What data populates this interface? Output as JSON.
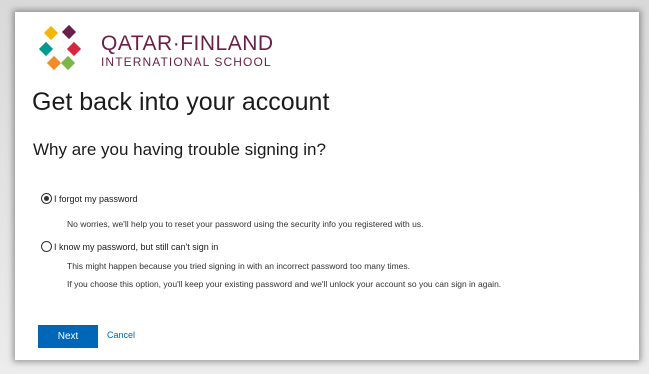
{
  "brand": {
    "name": "QATAR·FINLAND",
    "subtitle": "INTERNATIONAL SCHOOL",
    "colors": {
      "name_text": "#6a1f47",
      "leaf_yellow": "#f2b705",
      "leaf_red": "#d7263d",
      "leaf_teal": "#009a8e",
      "leaf_orange": "#f28c28",
      "leaf_maroon": "#6a1f47",
      "leaf_green": "#7ab648"
    }
  },
  "page": {
    "title": "Get back into your account",
    "question": "Why are you having trouble signing in?"
  },
  "options": [
    {
      "label": "I forgot my password",
      "checked": true,
      "descriptions": [
        "No worries, we'll help you to reset your password using the security info you registered with us."
      ]
    },
    {
      "label": "I know my password, but still can't sign in",
      "checked": false,
      "descriptions": [
        "This might happen because you tried signing in with an incorrect password too many times.",
        "If you choose this option, you'll keep your existing password and we'll unlock your account so you can sign in again."
      ]
    }
  ],
  "actions": {
    "next_label": "Next",
    "cancel_label": "Cancel",
    "primary_color": "#0067b8"
  }
}
